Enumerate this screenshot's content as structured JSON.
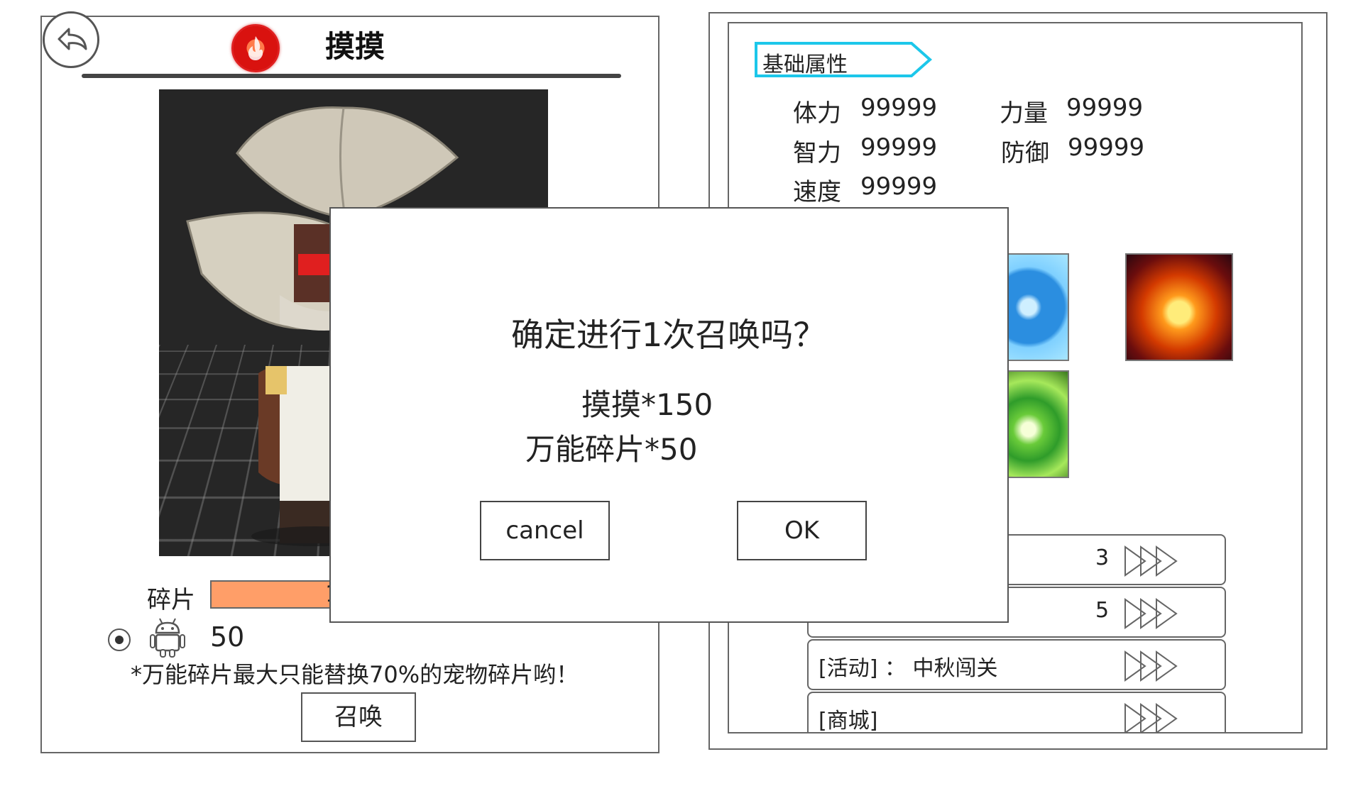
{
  "left": {
    "title": "摸摸",
    "fragment_label": "碎片",
    "fragment_value_partial": "1",
    "universal_fragment_count": "50",
    "hint": "*万能碎片最大只能替换70%的宠物碎片哟！",
    "summon_label": "召唤",
    "icons": {
      "back": "back-arrow-icon",
      "element": "fire-element-icon",
      "fragment": "android-icon"
    },
    "colors": {
      "fragment_bar": "#ff9e68",
      "element_icon": "#d9120f"
    }
  },
  "right": {
    "section_title": "基础属性",
    "section_tag_color": "#1cc7ea",
    "stats": [
      {
        "label": "体力",
        "value": "99999"
      },
      {
        "label": "力量",
        "value": "99999"
      },
      {
        "label": "智力",
        "value": "99999"
      },
      {
        "label": "防御",
        "value": "99999"
      },
      {
        "label": "速度",
        "value": "99999"
      }
    ],
    "skills": [
      "water-skill-icon",
      "fire-skill-icon",
      "nature-skill-icon"
    ],
    "sources": [
      {
        "text": "3"
      },
      {
        "text": "5"
      },
      {
        "text": "[活动]  ：  中秋闯关"
      },
      {
        "text": "[商城]"
      }
    ]
  },
  "dialog": {
    "question": "确定进行1次召唤吗？",
    "cost_1": "摸摸*150",
    "cost_2": "万能碎片*50",
    "cancel_label": "cancel",
    "ok_label": "OK"
  }
}
